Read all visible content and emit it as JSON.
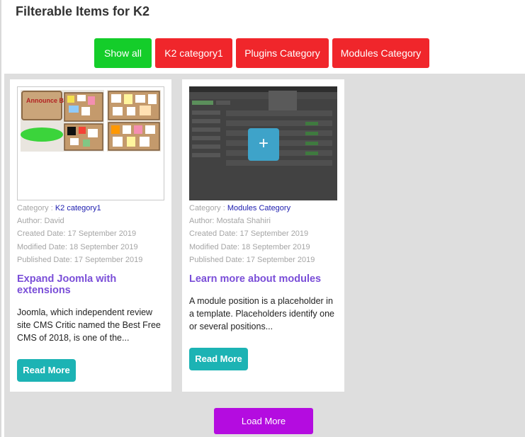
{
  "page": {
    "title": "Filterable Items for K2"
  },
  "filters": [
    {
      "label": "Show all",
      "active": true
    },
    {
      "label": "K2 category1",
      "active": false
    },
    {
      "label": "Plugins Category",
      "active": false
    },
    {
      "label": "Modules Category",
      "active": false
    }
  ],
  "colors": {
    "active_filter": "#14cd2a",
    "inactive_filter": "#f0262b",
    "title_link": "#7a4ed8",
    "read_more": "#1cb3b4",
    "load_more": "#b40ce0"
  },
  "items": [
    {
      "image_text": "Announce Board",
      "category_label": "Category",
      "category": "K2 category1",
      "author": "Author: David",
      "created": "Created Date: 17 September 2019",
      "modified": "Modified Date: 18 September 2019",
      "published": "Published Date: 17 September 2019",
      "title": "Expand Joomla with extensions",
      "excerpt": "Joomla, which independent review site CMS Critic named the Best Free CMS of 2018, is one of the...",
      "read_more": "Read More"
    },
    {
      "category_label": "Category",
      "category": "Modules Category",
      "author": "Author: Mostafa Shahiri",
      "created": "Created Date: 17 September 2019",
      "modified": "Modified Date: 18 September 2019",
      "published": "Published Date: 17 September 2019",
      "title": "Learn more about modules",
      "excerpt": "A module position is a placeholder in a template. Placeholders identify one or several positions...",
      "read_more": "Read More",
      "overlay_icon": "plus-icon"
    }
  ],
  "load_more": "Load More"
}
